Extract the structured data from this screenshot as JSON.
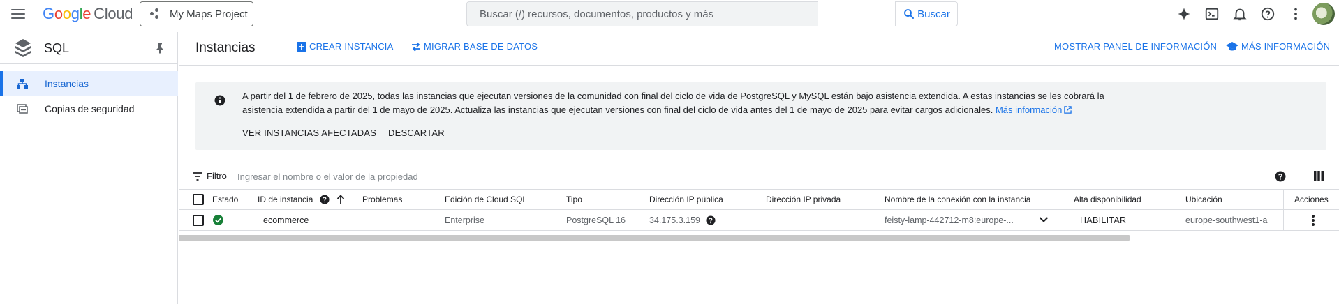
{
  "topbar": {
    "logo": {
      "google": "Google",
      "cloud": "Cloud"
    },
    "project": "My Maps Project",
    "search_placeholder": "Buscar (/) recursos, documentos, productos y más",
    "search_button": "Buscar",
    "icons": [
      "menu-icon",
      "sparkle-icon",
      "terminal-icon",
      "bell-icon",
      "help-icon",
      "more-vert-icon",
      "avatar"
    ]
  },
  "sidebar": {
    "title": "SQL",
    "items": [
      {
        "label": "Instancias",
        "icon": "instances-icon",
        "active": true
      },
      {
        "label": "Copias de seguridad",
        "icon": "backup-icon",
        "active": false
      }
    ]
  },
  "header": {
    "title": "Instancias",
    "create": "CREAR INSTANCIA",
    "migrate": "MIGRAR BASE DE DATOS",
    "show_panel": "MOSTRAR PANEL DE INFORMACIÓN",
    "more_info": "MÁS INFORMACIÓN"
  },
  "banner": {
    "line1": "A partir del 1 de febrero de 2025, todas las instancias que ejecutan versiones de la comunidad con final del ciclo de vida de PostgreSQL y MySQL están bajo asistencia extendida. A estas instancias se les cobrará la",
    "line2": "asistencia extendida a partir del 1 de mayo de 2025. Actualiza las instancias que ejecutan versiones con final del ciclo de vida antes del 1 de mayo de 2025 para evitar cargos adicionales.",
    "link": "Más información",
    "btn_affected": "VER INSTANCIAS AFECTADAS",
    "btn_dismiss": "DESCARTAR"
  },
  "filter": {
    "label": "Filtro",
    "placeholder": "Ingresar el nombre o el valor de la propiedad"
  },
  "table": {
    "columns": {
      "estado": "Estado",
      "id": "ID de instancia",
      "problemas": "Problemas",
      "edicion": "Edición de Cloud SQL",
      "tipo": "Tipo",
      "ip_publica": "Dirección IP pública",
      "ip_privada": "Dirección IP privada",
      "conexion": "Nombre de la conexión con la instancia",
      "alta": "Alta disponibilidad",
      "ubicacion": "Ubicación",
      "acciones": "Acciones"
    },
    "rows": [
      {
        "status": "ok",
        "id": "ecommerce",
        "problemas": "",
        "edicion": "Enterprise",
        "tipo": "PostgreSQL 16",
        "ip_publica": "34.175.3.159",
        "ip_privada": "",
        "conexion": "feisty-lamp-442712-m8:europe-...",
        "alta": "HABILITAR",
        "ubicacion": "europe-southwest1-a"
      }
    ]
  },
  "colors": {
    "accent": "#1a73e8",
    "status_ok": "#188038",
    "banner_bg": "#f1f3f4"
  }
}
